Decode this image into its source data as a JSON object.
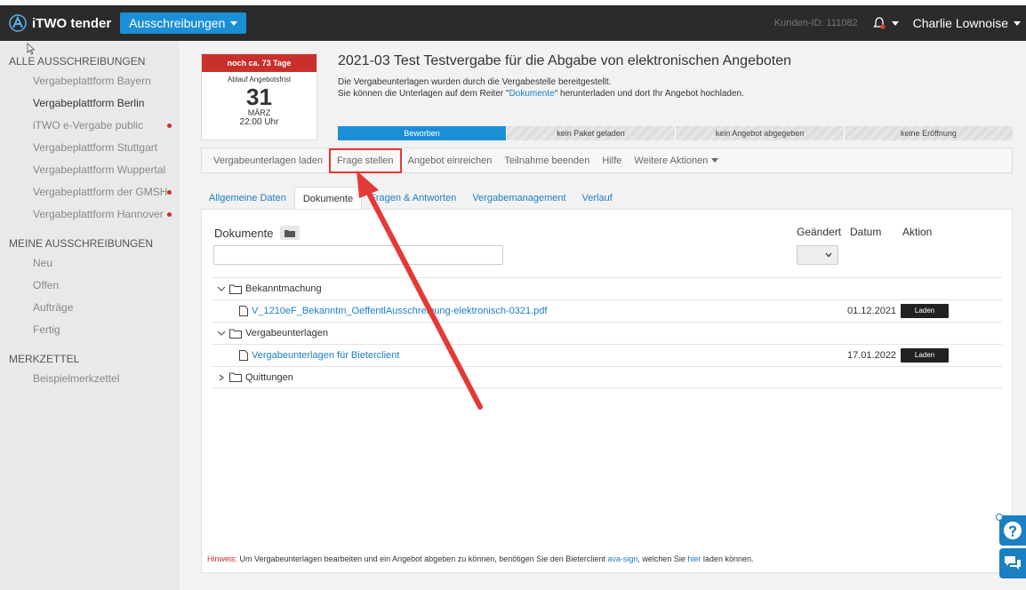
{
  "topbar": {
    "brand": "iTWO tender",
    "menu_label": "Ausschreibungen",
    "kunden_id": "Kunden-ID: 111082",
    "user_name": "Charlie Lownoise"
  },
  "sidebar": {
    "section1": "ALLE AUSSCHREIBUNGEN",
    "platforms": [
      {
        "label": "Vergabeplattform Bayern"
      },
      {
        "label": "Vergabeplattform Berlin"
      },
      {
        "label": "iTWO e-Vergabe public"
      },
      {
        "label": "Vergabeplattform Stuttgart"
      },
      {
        "label": "Vergabeplattform Wuppertal"
      },
      {
        "label": "Vergabeplattform der GMSH"
      },
      {
        "label": "Vergabeplattform Hannover"
      }
    ],
    "section2": "MEINE AUSSCHREIBUNGEN",
    "mine": [
      {
        "label": "Neu"
      },
      {
        "label": "Offen"
      },
      {
        "label": "Aufträge"
      },
      {
        "label": "Fertig"
      }
    ],
    "section3": "MERKZETTEL",
    "notes": [
      {
        "label": "Beispielmerkzettel"
      }
    ]
  },
  "deadline": {
    "remaining": "noch ca. 73 Tage",
    "label": "Ablauf Angebotsfrist",
    "day": "31",
    "month": "MÄRZ",
    "time": "22:00 Uhr"
  },
  "tender": {
    "title": "2021-03 Test Testvergabe für die Abgabe von elektronischen Angeboten",
    "line1": "Die Vergabeunterlagen wurden durch die Vergabestelle bereitgestellt.",
    "line2_pre": "Sie können die Unterlagen auf dem Reiter \"",
    "line2_link": "Dokumente",
    "line2_post": "\" herunterladen und dort Ihr Angebot hochladen."
  },
  "progress": [
    "Beworben",
    "kein Paket geladen",
    "kein Angebot abgegeben",
    "keine Eröffnung"
  ],
  "actions": {
    "load": "Vergabeunterlagen laden",
    "ask": "Frage stellen",
    "submit": "Angebot einreichen",
    "end": "Teilnahme beenden",
    "help": "Hilfe",
    "more": "Weitere Aktionen"
  },
  "tabs": [
    "Allgemeine Daten",
    "Dokumente",
    "Fragen & Antworten",
    "Vergabemanagement",
    "Verlauf"
  ],
  "documents": {
    "heading": "Dokumente",
    "col_changed": "Geändert",
    "col_date": "Datum",
    "col_action": "Aktion",
    "folder1": "Bekanntmachung",
    "file1": "V_1210eF_Bekanntm_OeffentlAusschreibung-elektronisch-0321.pdf",
    "file1_date": "01.12.2021",
    "folder2": "Vergabeunterlagen",
    "file2": "Vergabeunterlagen für Bieterclient",
    "file2_date": "17.01.2022",
    "folder3": "Quittungen",
    "load_btn": "Laden"
  },
  "hint": {
    "label": "Hinweis:",
    "text1": " Um Vergabeunterlagen bearbeiten und ein Angebot abgeben zu können, benötigen Sie den Bieterclient ",
    "link1": "ava-sign",
    "text2": ", welchen Sie ",
    "link2": "hier",
    "text3": " laden können."
  },
  "colors": {
    "accent": "#1b8fd6",
    "danger": "#c9302c",
    "annotation": "#e53935"
  }
}
